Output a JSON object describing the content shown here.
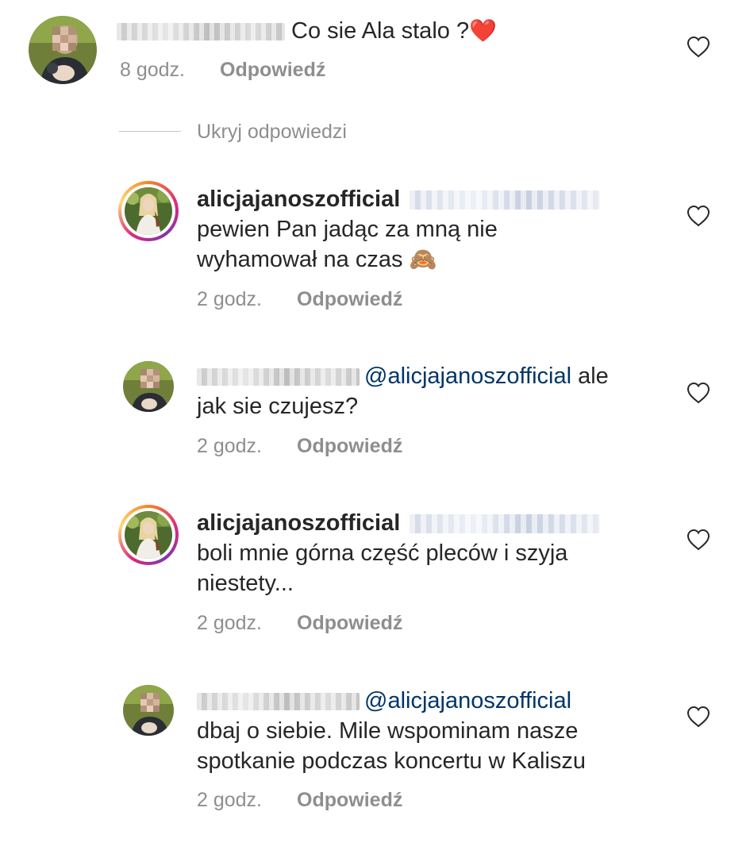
{
  "colors": {
    "text": "#262626",
    "secondary": "#8e8e8e",
    "mention": "#003569",
    "heart_emoji": "#e0245e"
  },
  "hide_replies_label": "Ukryj odpowiedzi",
  "comments": [
    {
      "username": "",
      "username_blurred": true,
      "text": "Co sie Ala stalo ?",
      "emoji": "heart",
      "time": "8 godz.",
      "reply_label": "Odpowiedź",
      "like_icon": "heart-outline-icon"
    },
    {
      "username": "alicjajanoszofficial",
      "mention_blurred": true,
      "text_line1": "pewien Pan jadąc za mną nie",
      "text_line2": "wyhamował na czas",
      "emoji": "see-no-evil-monkey",
      "time": "2 godz.",
      "reply_label": "Odpowiedź",
      "like_icon": "heart-outline-icon"
    },
    {
      "username": "",
      "username_blurred": true,
      "mention": "@alicjajanoszofficial",
      "text_line1_tail": "ale",
      "text_line2": "jak sie czujesz?",
      "time": "2 godz.",
      "reply_label": "Odpowiedź",
      "like_icon": "heart-outline-icon"
    },
    {
      "username": "alicjajanoszofficial",
      "mention_blurred": true,
      "text_line1": "boli mnie górna część pleców i szyja",
      "text_line2": "niestety...",
      "time": "2 godz.",
      "reply_label": "Odpowiedź",
      "like_icon": "heart-outline-icon"
    },
    {
      "username": "",
      "username_blurred": true,
      "mention": "@alicjajanoszofficial",
      "text_line1": "dbaj o siebie. Mile wspominam nasze",
      "text_line2": "spotkanie podczas koncertu w Kaliszu",
      "time": "2 godz.",
      "reply_label": "Odpowiedź",
      "like_icon": "heart-outline-icon"
    }
  ]
}
